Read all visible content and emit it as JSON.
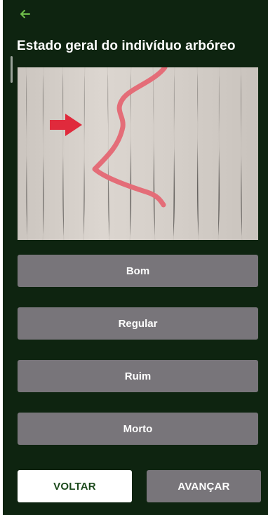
{
  "header": {
    "back_icon": "arrow-left-icon",
    "title": "Estado geral do indivíduo arbóreo"
  },
  "photo": {
    "icon": "tree-trunk-photo",
    "arrow_color": "#e02a3c",
    "line_color": "#e46d78"
  },
  "options": [
    {
      "label": "Bom"
    },
    {
      "label": "Regular"
    },
    {
      "label": "Ruim"
    },
    {
      "label": "Morto"
    }
  ],
  "footer": {
    "back_label": "VOLTAR",
    "next_label": "AVANÇAR"
  },
  "colors": {
    "background": "#0e2410",
    "option_button": "#78757a",
    "back_button_text": "#1c4a1c",
    "back_arrow": "#6fbf4a"
  }
}
